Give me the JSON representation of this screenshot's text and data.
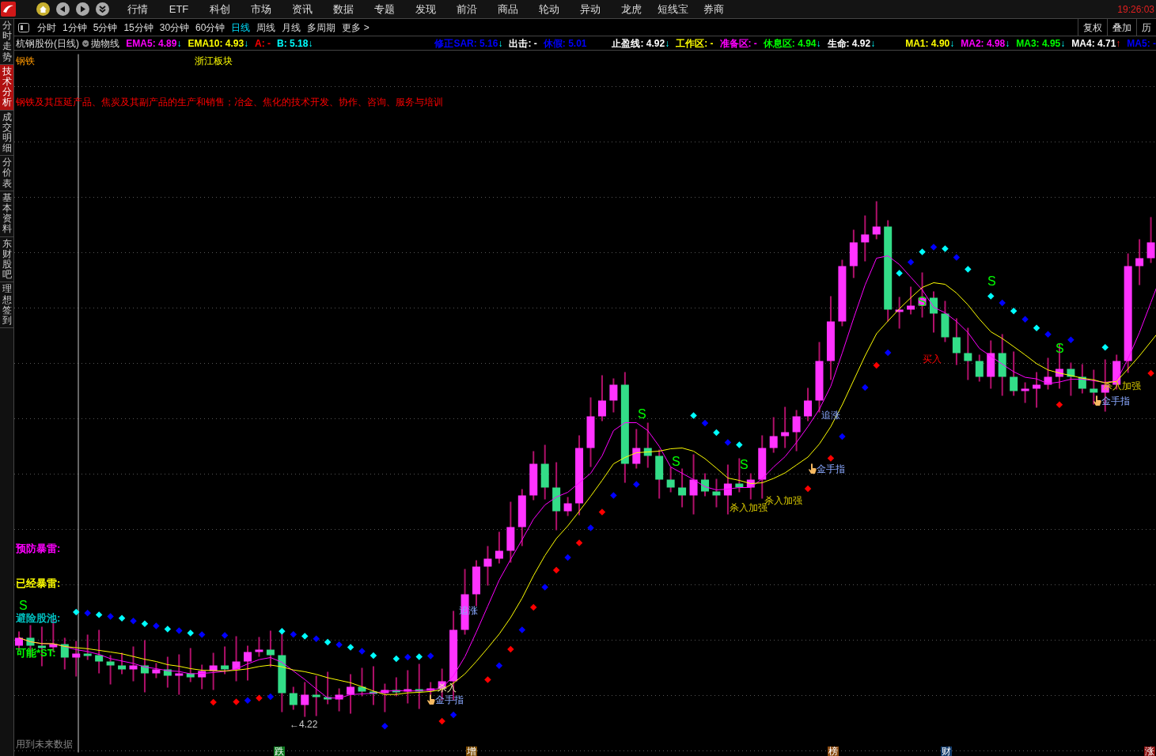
{
  "menu": {
    "items": [
      "行情",
      "ETF",
      "科创",
      "市场",
      "资讯",
      "数据",
      "专题",
      "发现",
      "前沿",
      "商品",
      "轮动",
      "异动",
      "龙虎",
      "短线宝",
      "券商"
    ],
    "clock": "19:26:03"
  },
  "periods": [
    {
      "label": "分时",
      "selected": false
    },
    {
      "label": "1分钟",
      "selected": false
    },
    {
      "label": "5分钟",
      "selected": false
    },
    {
      "label": "15分钟",
      "selected": false
    },
    {
      "label": "30分钟",
      "selected": false
    },
    {
      "label": "60分钟",
      "selected": false
    },
    {
      "label": "日线",
      "selected": true
    },
    {
      "label": "周线",
      "selected": false
    },
    {
      "label": "月线",
      "selected": false
    },
    {
      "label": "多周期",
      "selected": false
    },
    {
      "label": "更多 >",
      "selected": false
    }
  ],
  "tools": [
    "复权",
    "叠加",
    "历"
  ],
  "side_tabs": [
    {
      "label": "分时走势",
      "selected": false
    },
    {
      "label": "技术分析",
      "selected": true
    },
    {
      "label": "成交明细",
      "selected": false
    },
    {
      "label": "分价表",
      "selected": false
    },
    {
      "label": "基本资料",
      "selected": false
    },
    {
      "label": "东财股吧",
      "selected": false
    },
    {
      "label": "理想签到",
      "selected": false
    }
  ],
  "legend": {
    "title": "杭钢股份(日线)",
    "indicator": "抛物线",
    "groups": [
      [
        {
          "text": "EMA5: 4.89",
          "color": "#ff00ff",
          "arrow": "↓",
          "rising": false
        },
        {
          "text": "EMA10: 4.93",
          "color": "#ffff00",
          "arrow": "↓",
          "rising": false
        },
        {
          "text": "A: -",
          "color": "#ff0000"
        },
        {
          "text": "B: 5.18",
          "color": "#00ffff",
          "arrow": "↓",
          "rising": false
        }
      ],
      [
        {
          "text": "修正SAR: 5.16",
          "color": "#0000ff",
          "arrow": "↓",
          "rising": false
        },
        {
          "text": "出击: -",
          "color": "#ffffff"
        },
        {
          "text": "休假: 5.01",
          "color": "#0000ff"
        }
      ],
      [
        {
          "text": "止盈线: 4.92",
          "color": "#ffffff",
          "arrow": "↓",
          "rising": false
        },
        {
          "text": "工作区: -",
          "color": "#ffff00"
        },
        {
          "text": "准备区: -",
          "color": "#ff00ff"
        },
        {
          "text": "休息区: 4.94",
          "color": "#00ff00",
          "arrow": "↓",
          "rising": false
        },
        {
          "text": "生命: 4.92",
          "color": "#ffffff",
          "arrow": "↓",
          "rising": false
        }
      ],
      [
        {
          "text": "MA1: 4.90",
          "color": "#ffff00",
          "arrow": "↓",
          "rising": false
        },
        {
          "text": "MA2: 4.98",
          "color": "#ff00ff",
          "arrow": "↓",
          "rising": false
        },
        {
          "text": "MA3: 4.95",
          "color": "#00ff00",
          "arrow": "↓",
          "rising": false
        },
        {
          "text": "MA4: 4.71",
          "color": "#ffffff",
          "arrow": "↑",
          "rising": true
        },
        {
          "text": "MA5: -",
          "color": "#0000ff"
        }
      ]
    ]
  },
  "chart": {
    "sector": "钢铁",
    "region": "浙江板块",
    "business": "钢铁及其压延产品、焦炭及其副产品的生产和销售；冶金、焦化的技术开发、协作、咨询、服务与培训",
    "warnings": [
      {
        "label": "预防暴雷:",
        "color": "#ff00ff"
      },
      {
        "label": "已经暴雷:",
        "color": "#ffff00"
      },
      {
        "label": "避险股池:",
        "color": "#00c0c0"
      },
      {
        "label": "可能*ST:",
        "color": "#00ff00"
      }
    ],
    "footnote": "用到未来数据",
    "signals": [
      {
        "text": "S",
        "kind": "s"
      },
      {
        "text": "←4.22",
        "kind": "low"
      },
      {
        "text": "金手指",
        "kind": "finger"
      },
      {
        "text": "杀入",
        "kind": "enter"
      },
      {
        "text": "追涨",
        "kind": "chase"
      },
      {
        "text": "S",
        "kind": "s"
      },
      {
        "text": "S",
        "kind": "s"
      },
      {
        "text": "杀入加强",
        "kind": "strong"
      },
      {
        "text": "S",
        "kind": "s"
      },
      {
        "text": "杀入加强",
        "kind": "strong"
      },
      {
        "text": "金手指",
        "kind": "finger"
      },
      {
        "text": "追涨",
        "kind": "chase"
      },
      {
        "text": "S",
        "kind": "s"
      },
      {
        "text": "买入",
        "kind": "buy"
      },
      {
        "text": "S",
        "kind": "s"
      },
      {
        "text": "S",
        "kind": "s"
      },
      {
        "text": "金手指",
        "kind": "finger"
      },
      {
        "text": "杀入加强",
        "kind": "strong"
      }
    ],
    "markers": [
      {
        "text": "跌",
        "color": "#117a22"
      },
      {
        "text": "增",
        "color": "#7a4a00"
      },
      {
        "text": "榜",
        "color": "#8a4a10"
      },
      {
        "text": "财",
        "color": "#123a6a"
      },
      {
        "text": "涨",
        "color": "#8a1010"
      }
    ]
  }
}
